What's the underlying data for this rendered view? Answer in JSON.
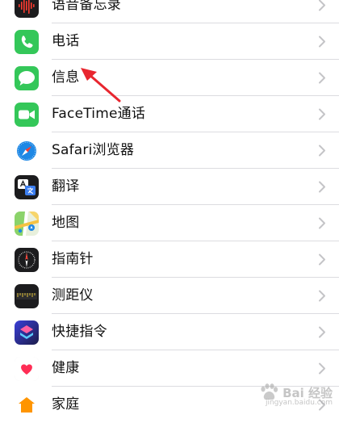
{
  "settings_list": [
    {
      "label": "语音备忘录",
      "icon": "voice-memos-icon",
      "color": "#1c1c1e"
    },
    {
      "label": "电话",
      "icon": "phone-icon",
      "color": "#34c759"
    },
    {
      "label": "信息",
      "icon": "messages-icon",
      "color": "#34c759"
    },
    {
      "label": "FaceTime通话",
      "icon": "facetime-icon",
      "color": "#34c759"
    },
    {
      "label": "Safari浏览器",
      "icon": "safari-icon",
      "color": "#1e88e5"
    },
    {
      "label": "翻译",
      "icon": "translate-icon",
      "color": "#1c1c1e"
    },
    {
      "label": "地图",
      "icon": "maps-icon",
      "color": "#8bd36a"
    },
    {
      "label": "指南针",
      "icon": "compass-icon",
      "color": "#1c1c1e"
    },
    {
      "label": "测距仪",
      "icon": "measure-icon",
      "color": "#1c1c1e"
    },
    {
      "label": "快捷指令",
      "icon": "shortcuts-icon",
      "color": "#5b3bd6"
    },
    {
      "label": "健康",
      "icon": "health-icon",
      "color": "#ff2d55"
    },
    {
      "label": "家庭",
      "icon": "home-icon",
      "color": "#ff9500"
    }
  ],
  "annotation": {
    "icon": "red-arrow-icon",
    "color": "#e8262f"
  },
  "watermark": {
    "text": "Bai 经验",
    "sub": "jingyan.baidu.com"
  }
}
